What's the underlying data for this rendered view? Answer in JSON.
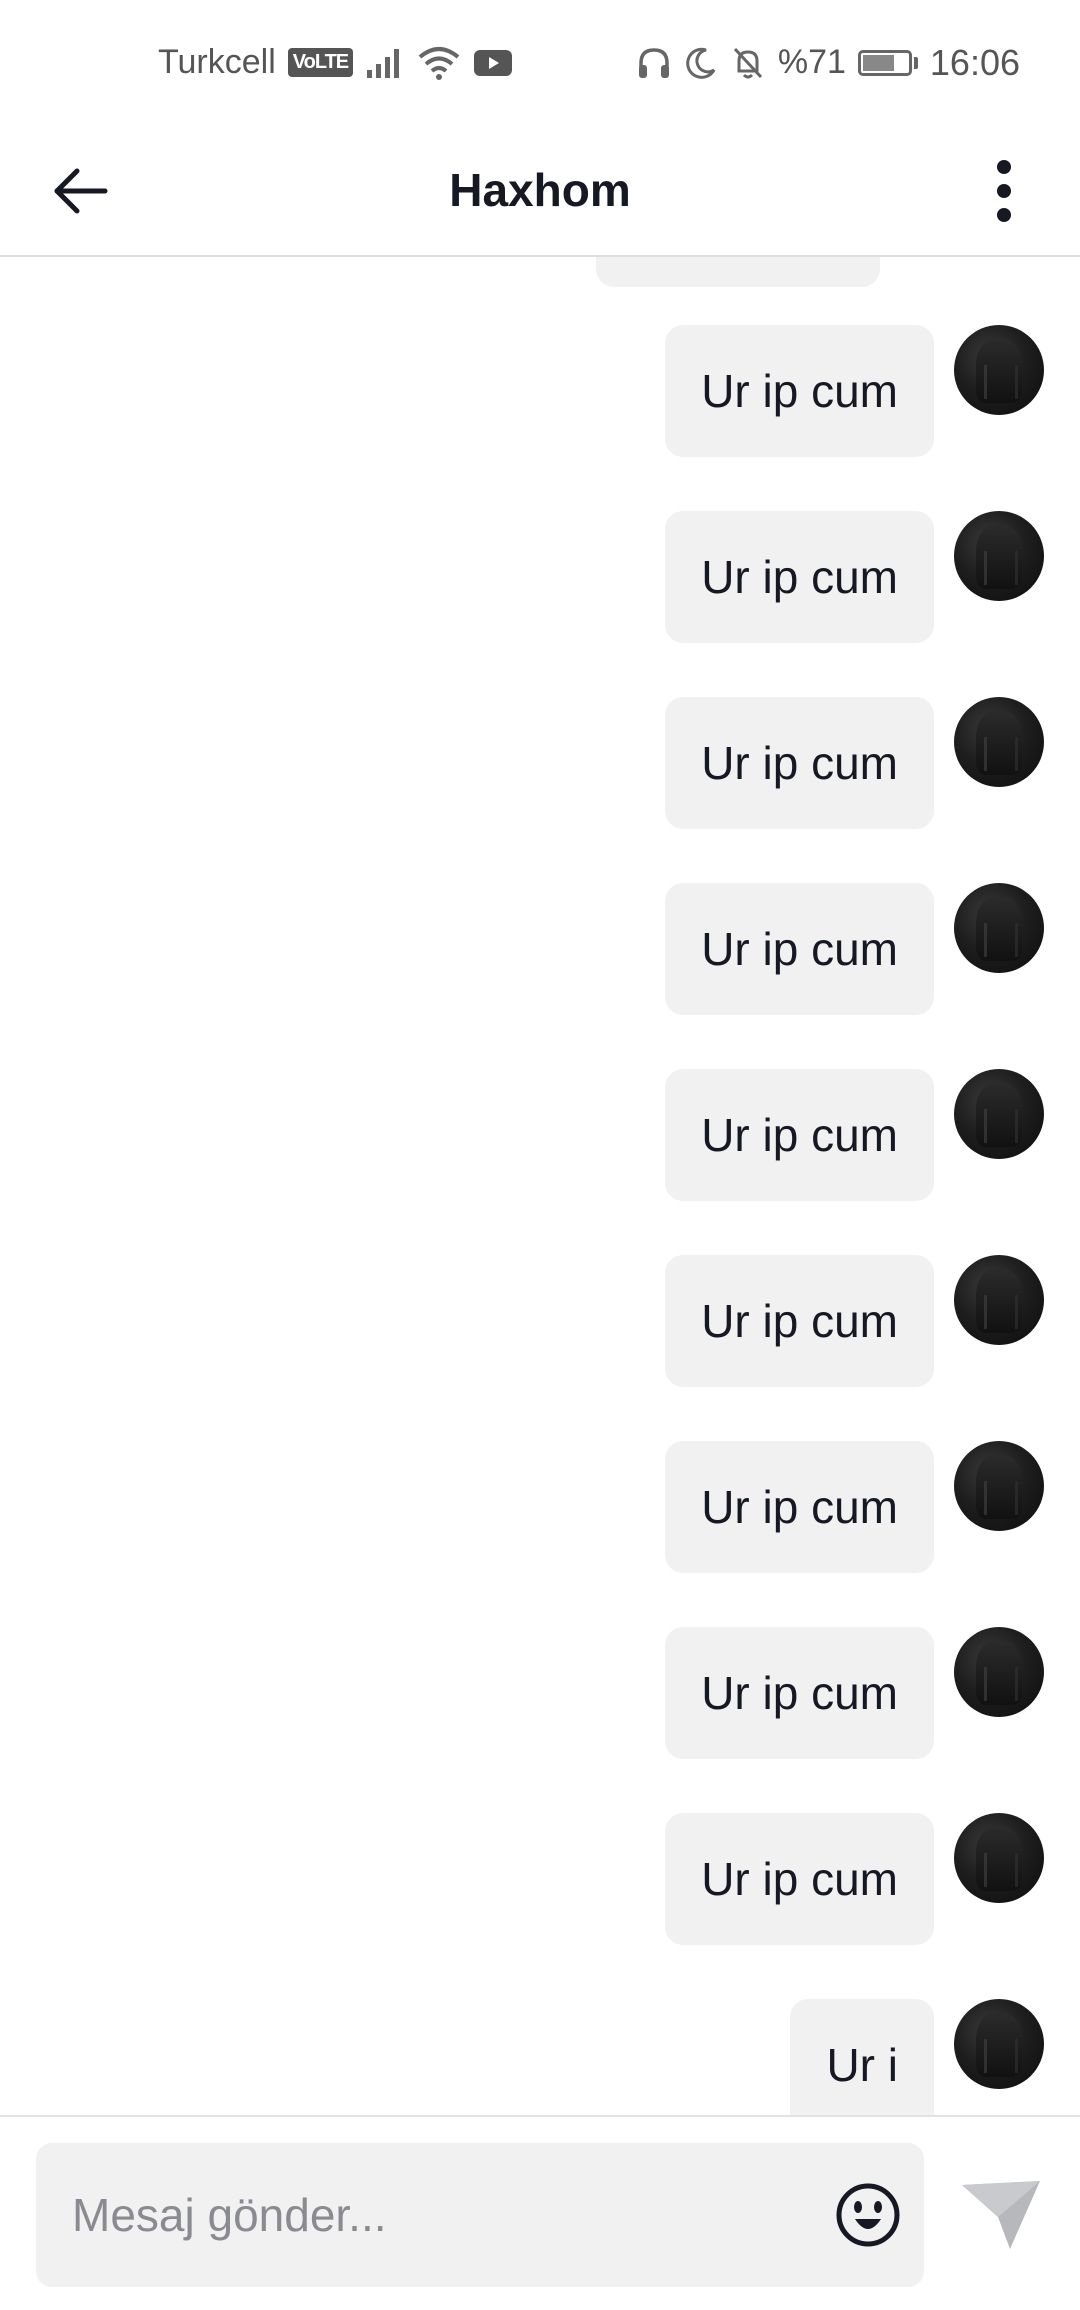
{
  "status_bar": {
    "carrier": "Turkcell",
    "volte": "VoLTE",
    "battery_percent": "%71",
    "battery_level": 0.71,
    "time": "16:06",
    "icons": [
      "signal-icon",
      "wifi-icon",
      "youtube-icon",
      "headphones-icon",
      "moon-icon",
      "bell-off-icon",
      "battery-icon"
    ]
  },
  "header": {
    "title": "Haxhom",
    "back_icon": "arrow-left-icon",
    "more_icon": "more-vertical-icon"
  },
  "messages": [
    {
      "text": "Ur ip cum"
    },
    {
      "text": "Ur ip cum"
    },
    {
      "text": "Ur ip cum"
    },
    {
      "text": "Ur ip cum"
    },
    {
      "text": "Ur ip cum"
    },
    {
      "text": "Ur ip cum"
    },
    {
      "text": "Ur ip cum"
    },
    {
      "text": "Ur ip cum"
    },
    {
      "text": "Ur ip cum"
    },
    {
      "text": "Ur i"
    }
  ],
  "composer": {
    "placeholder": "Mesaj gönder...",
    "value": "",
    "emoji_icon": "emoji-icon",
    "send_icon": "send-icon"
  },
  "colors": {
    "bubble": "#f1f1f2",
    "text": "#161823",
    "placeholder": "#8a8b91",
    "send_disabled": "#b7b8bc"
  }
}
